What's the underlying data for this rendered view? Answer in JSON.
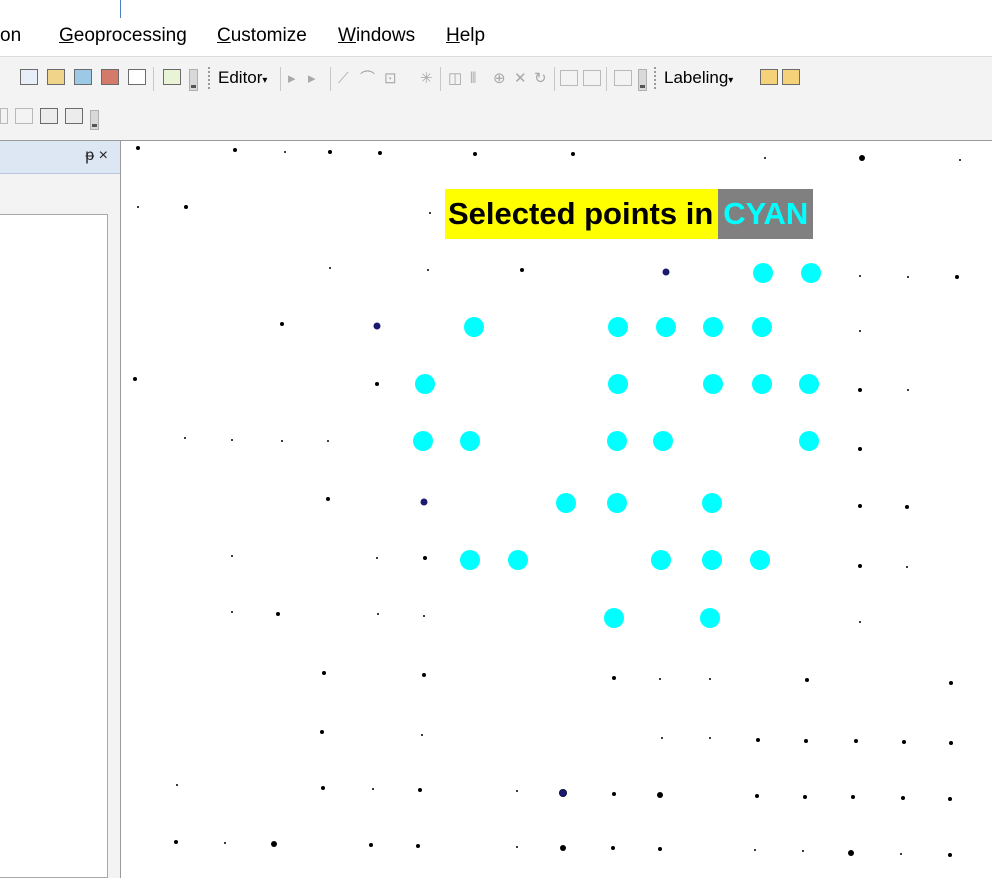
{
  "menu": {
    "items": [
      {
        "label": "on",
        "accel": ""
      },
      {
        "label": "Geoprocessing",
        "accel": "G"
      },
      {
        "label": "Customize",
        "accel": "C"
      },
      {
        "label": "Windows",
        "accel": "W"
      },
      {
        "label": "Help",
        "accel": "H"
      }
    ]
  },
  "toolbar": {
    "editor_label": "Editor",
    "labeling_label": "Labeling"
  },
  "panel": {
    "pin_glyph": "ᵽ",
    "close_glyph": "×"
  },
  "map": {
    "annotation_text": "Selected points in ",
    "annotation_color_word": "CYAN",
    "colors": {
      "selected": "#00ffff",
      "unselected": "#000000",
      "dark_blue": "#1a1a6e"
    }
  }
}
